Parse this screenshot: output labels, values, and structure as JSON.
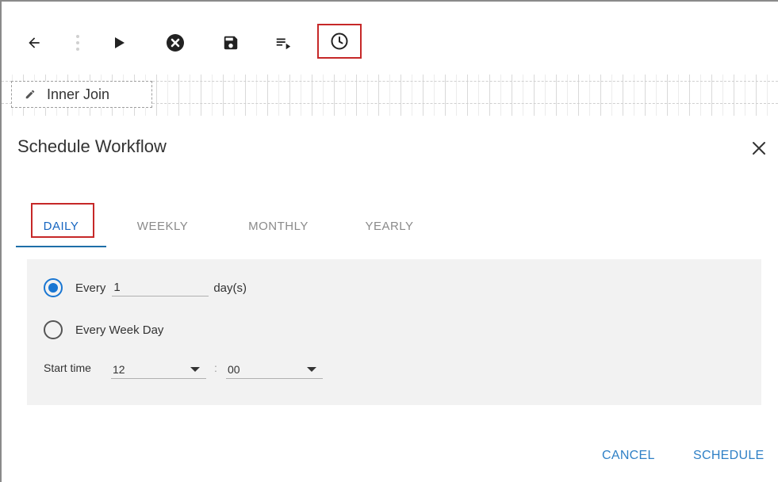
{
  "toolbar": {
    "buttons": [
      {
        "name": "back-button",
        "icon": "arrow-left-icon"
      },
      {
        "name": "more-button",
        "icon": "vertical-dots-icon"
      },
      {
        "name": "run-button",
        "icon": "play-icon"
      },
      {
        "name": "cancel-run-button",
        "icon": "cancel-circle-icon"
      },
      {
        "name": "save-button",
        "icon": "save-icon"
      },
      {
        "name": "playlist-button",
        "icon": "playlist-play-icon"
      },
      {
        "name": "schedule-button",
        "icon": "clock-icon"
      }
    ]
  },
  "canvas": {
    "node_label": "Inner Join"
  },
  "dialog": {
    "title": "Schedule Workflow",
    "tabs": [
      {
        "label": "DAILY",
        "active": true
      },
      {
        "label": "WEEKLY",
        "active": false
      },
      {
        "label": "MONTHLY",
        "active": false
      },
      {
        "label": "YEARLY",
        "active": false
      }
    ],
    "daily": {
      "every_label": "Every",
      "every_value": "1",
      "every_unit": "day(s)",
      "every_selected": true,
      "weekday_label": "Every Week Day",
      "weekday_selected": false,
      "start_time_label": "Start time",
      "hour": "12",
      "separator": ":",
      "minute": "00"
    },
    "actions": {
      "cancel": "CANCEL",
      "schedule": "SCHEDULE"
    }
  },
  "colors": {
    "accent": "#1976d2",
    "highlight": "#c62828",
    "panel": "#f2f2f2"
  }
}
